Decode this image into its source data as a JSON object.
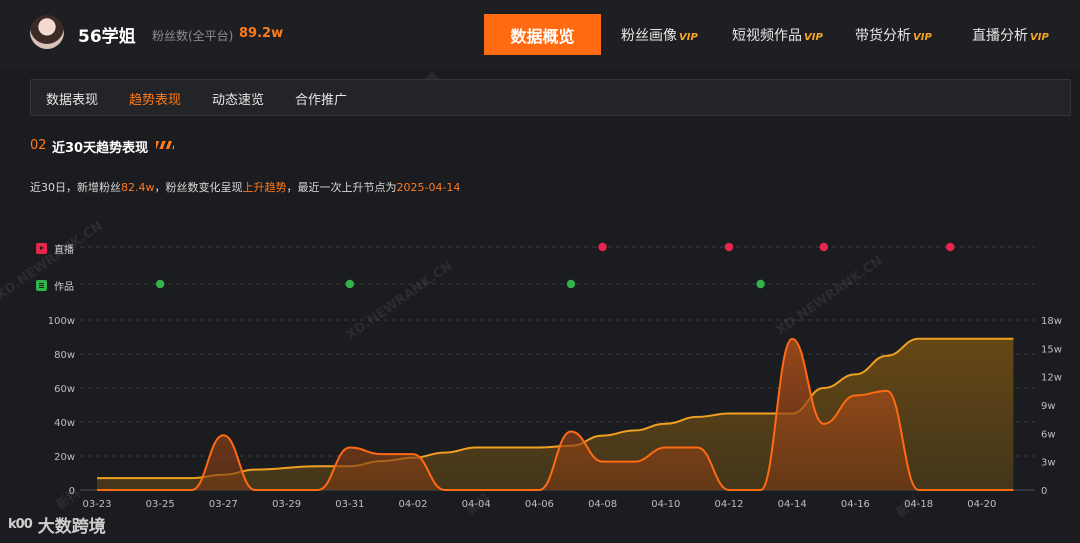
{
  "header": {
    "username": "56学姐",
    "fans_label": "粉丝数(全平台)",
    "fans_value": "89.2w",
    "nav": [
      {
        "label": "数据概览",
        "vip": "",
        "active": true
      },
      {
        "label": "粉丝画像",
        "vip": "VIP"
      },
      {
        "label": "短视频作品",
        "vip": "VIP"
      },
      {
        "label": "带货分析",
        "vip": "VIP"
      },
      {
        "label": "直播分析",
        "vip": "VIP"
      }
    ]
  },
  "subnav": {
    "tabs": [
      {
        "label": "数据表现"
      },
      {
        "label": "趋势表现",
        "active": true
      },
      {
        "label": "动态速览"
      },
      {
        "label": "合作推广"
      }
    ]
  },
  "section": {
    "number": "02",
    "title": "近30天趋势表现",
    "summary": {
      "p1": "近30日，新增粉丝",
      "new_fans": "82.4w",
      "p2": "，粉丝数变化呈现",
      "trend": "上升趋势",
      "p3": "，最近一次上升节点为",
      "last_rise": "2025-04-14"
    }
  },
  "brand": {
    "logo_text": "大数跨境",
    "logo_mark": "k00"
  },
  "watermarks": [
    "XD.NEWRANK.CN",
    "XD.NEWRANK.CN",
    "XD.NEWRANK.CN",
    "新抖",
    "新抖",
    "新抖"
  ],
  "colors": {
    "accent": "#ff6a13",
    "cumulative_line": "#f0a020",
    "daily_line": "#ff6a13",
    "live_dot": "#e8264b",
    "works_dot": "#33b34a"
  },
  "chart_data": {
    "type": "area",
    "x_ticks": [
      "03-23",
      "03-25",
      "03-27",
      "03-29",
      "03-31",
      "04-02",
      "04-04",
      "04-06",
      "04-08",
      "04-10",
      "04-12",
      "04-14",
      "04-16",
      "04-18",
      "04-20"
    ],
    "y_left_ticks": [
      "100w",
      "80w",
      "60w",
      "40w",
      "20w",
      "0"
    ],
    "y_right_ticks": [
      "18w",
      "15w",
      "12w",
      "9w",
      "6w",
      "3w",
      "0"
    ],
    "y_left_range": [
      0,
      100
    ],
    "y_right_range": [
      0,
      18
    ],
    "event_rows": [
      {
        "name": "直播",
        "icon": "live-icon",
        "dates": [
          "04-08",
          "04-12",
          "04-15",
          "04-19"
        ]
      },
      {
        "name": "作品",
        "icon": "works-icon",
        "dates": [
          "03-25",
          "03-31",
          "04-07",
          "04-13"
        ]
      }
    ],
    "series": [
      {
        "axis": "left",
        "x": [
          "03-23",
          "03-26",
          "03-27",
          "03-28",
          "03-30",
          "03-31",
          "04-01",
          "04-02",
          "04-03",
          "04-04",
          "04-05",
          "04-06",
          "04-07",
          "04-08",
          "04-09",
          "04-10",
          "04-11",
          "04-12",
          "04-13",
          "04-14",
          "04-15",
          "04-16",
          "04-17",
          "04-18",
          "04-19",
          "04-20",
          "04-21"
        ],
        "values": [
          7,
          7,
          9,
          12,
          14,
          14,
          17,
          19,
          22,
          25,
          25,
          25,
          26,
          32,
          35,
          39,
          43,
          45,
          45,
          45,
          60,
          68,
          79,
          89,
          89,
          89,
          89
        ]
      },
      {
        "axis": "right",
        "x": [
          "03-23",
          "03-26",
          "03-27",
          "03-28",
          "03-29",
          "03-30",
          "03-31",
          "04-01",
          "04-02",
          "04-03",
          "04-04",
          "04-05",
          "04-06",
          "04-07",
          "04-08",
          "04-09",
          "04-10",
          "04-11",
          "04-12",
          "04-13",
          "04-14",
          "04-15",
          "04-16",
          "04-17",
          "04-18",
          "04-19",
          "04-20",
          "04-21"
        ],
        "values": [
          0,
          0,
          5.8,
          0,
          0,
          0,
          4.5,
          3.8,
          3.8,
          0,
          0,
          0,
          0,
          6.2,
          3,
          3,
          4.5,
          4.5,
          0,
          0,
          16,
          7,
          10,
          10.5,
          0,
          0,
          0,
          0
        ]
      }
    ]
  }
}
